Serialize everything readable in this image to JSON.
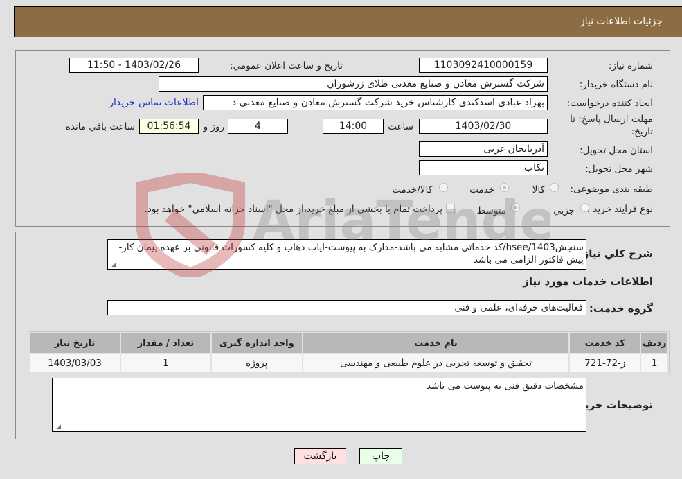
{
  "header": {
    "title": "جزئیات اطلاعات نیاز"
  },
  "details": {
    "need_number_label": "شماره نیاز:",
    "need_number": "1103092410000159",
    "announce_label": "تاريخ و ساعت اعلان عمومي:",
    "announce_value": "1403/02/26 - 11:50",
    "buyer_org_label": "نام دستگاه خريدار:",
    "buyer_org": "شرکت گسترش معادن و صنایع معدنی طلای زرشوران",
    "creator_label": "ايجاد کننده درخواست:",
    "creator": "بهزاد عبادی اسدکندی کارشناس خرید  شرکت گسترش معادن و صنایع معدنی د",
    "contact_link": "اطلاعات تماس خريدار",
    "deadline_label": "مهلت ارسال پاسخ: تا تاريخ:",
    "deadline_date": "1403/02/30",
    "time_label": "ساعت",
    "deadline_time": "14:00",
    "days_value": "4",
    "days_label": "روز و",
    "remaining_time": "01:56:54",
    "remaining_label": "ساعت باقي مانده",
    "province_label": "استان محل تحويل:",
    "province": "آذربایجان غربی",
    "city_label": "شهر محل تحويل:",
    "city": "تکاب",
    "category_label": "طبقه بندی موضوعی:",
    "category_options": [
      {
        "label": "کالا",
        "checked": false
      },
      {
        "label": "خدمت",
        "checked": true
      },
      {
        "label": "کالا/خدمت",
        "checked": false
      }
    ],
    "process_label": "نوع فرآيند خريد :",
    "process_options": [
      {
        "label": "جزيي",
        "checked": false
      },
      {
        "label": "متوسط",
        "checked": true
      }
    ],
    "treasury_note": "پرداخت تمام یا بخشی از مبلغ خرید،از محل \"اسناد خزانه اسلامی\" خواهد بود."
  },
  "description": {
    "label": "شرح کلي نياز:",
    "text": "سنجش1403/hsee/کد خدماتی مشابه می باشد-مدارک به پیوست-ایاب ذهاب و کلیه کسورات قانونی بر عهده پیمان کار-پیش فاکتور الزامی می باشد"
  },
  "services": {
    "section_title": "اطلاعات خدمات مورد نياز",
    "group_label": "گروه خدمت:",
    "group_value": "فعالیت‌های حرفه‌ای، علمی و فنی",
    "columns": [
      "رديف",
      "کد خدمت",
      "نام خدمت",
      "واحد اندازه گيری",
      "تعداد / مقدار",
      "تاريخ نياز"
    ],
    "rows": [
      [
        "1",
        "ز-72-721",
        "تحقیق و توسعه تجربی در علوم طبیعی و مهندسی",
        "پروژه",
        "1",
        "1403/03/03"
      ]
    ]
  },
  "buyer_notes": {
    "label": "توضيحات خريدار:",
    "text": "مشخصات دقیق فنی به پیوست می باشد"
  },
  "buttons": {
    "print": "چاپ",
    "back": "بازگشت"
  },
  "watermark": {
    "text": "AriaTender.neT"
  }
}
